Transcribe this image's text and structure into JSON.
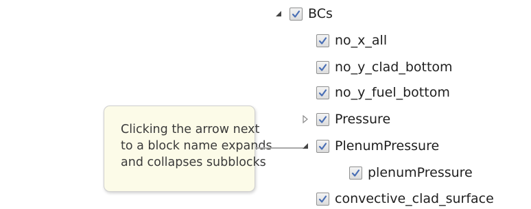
{
  "tree": {
    "items": [
      {
        "label": "BCs",
        "arrow": "expanded-arrow-icon",
        "checked": true,
        "level": 0
      },
      {
        "label": "no_x_all",
        "arrow": null,
        "checked": true,
        "level": 1
      },
      {
        "label": "no_y_clad_bottom",
        "arrow": null,
        "checked": true,
        "level": 1
      },
      {
        "label": "no_y_fuel_bottom",
        "arrow": null,
        "checked": true,
        "level": 1
      },
      {
        "label": "Pressure",
        "arrow": "collapsed-arrow-icon",
        "checked": true,
        "level": 1
      },
      {
        "label": "PlenumPressure",
        "arrow": "expanded-arrow-icon",
        "checked": true,
        "level": 1
      },
      {
        "label": "plenumPressure",
        "arrow": null,
        "checked": true,
        "level": 2
      },
      {
        "label": "convective_clad_surface",
        "arrow": null,
        "checked": true,
        "level": 1
      }
    ]
  },
  "callout": {
    "lines": [
      "Clicking the arrow next",
      "to a block name expands",
      "and collapses subblocks"
    ]
  },
  "colors": {
    "checkmark": "#4a6fb5",
    "callout_background": "#fcfbe8",
    "connector": "#a8a8a8",
    "label_text": "#1e1e1e"
  }
}
